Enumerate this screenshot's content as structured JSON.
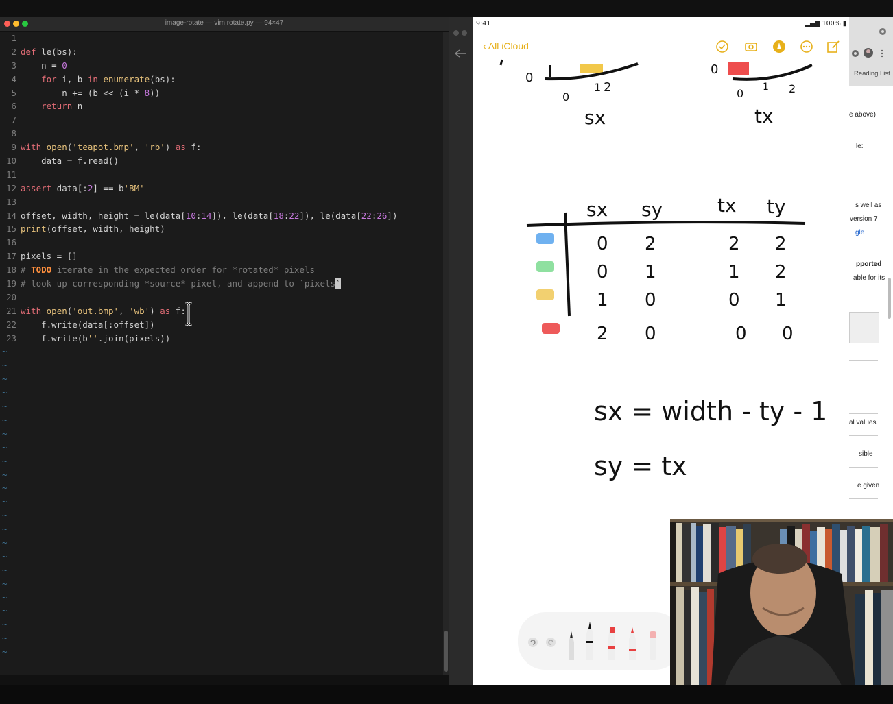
{
  "terminal": {
    "title": "image-rotate — vim rotate.py — 94×47",
    "lines": [
      {
        "n": "1"
      },
      {
        "n": "2"
      },
      {
        "n": "3"
      },
      {
        "n": "4"
      },
      {
        "n": "5"
      },
      {
        "n": "6"
      },
      {
        "n": "7"
      },
      {
        "n": "8"
      },
      {
        "n": "9"
      },
      {
        "n": "10"
      },
      {
        "n": "11"
      },
      {
        "n": "12"
      },
      {
        "n": "13"
      },
      {
        "n": "14"
      },
      {
        "n": "15"
      },
      {
        "n": "16"
      },
      {
        "n": "17"
      },
      {
        "n": "18"
      },
      {
        "n": "19"
      },
      {
        "n": "20"
      },
      {
        "n": "21"
      },
      {
        "n": "22"
      },
      {
        "n": "23"
      }
    ],
    "code": {
      "l2": {
        "kw": "def",
        "rest": " le(bs):"
      },
      "l3": {
        "a": "    n = ",
        "num": "0"
      },
      "l4": {
        "kw1": "    for",
        "a": " i, b ",
        "kw2": "in",
        "sp": " ",
        "fn": "enumerate",
        "b": "(bs):"
      },
      "l5": {
        "a": "        n += (b << (i * ",
        "num": "8",
        "b": "))"
      },
      "l6": {
        "kw": "    return",
        "a": " n"
      },
      "l9": {
        "kw1": "with",
        "sp": " ",
        "fn": "open",
        "a": "(",
        "s1": "'teapot.bmp'",
        "b": ", ",
        "s2": "'rb'",
        "c": ") ",
        "kw2": "as",
        "d": " f:"
      },
      "l10": {
        "a": "    data = f.read()"
      },
      "l12": {
        "kw": "assert",
        "a": " data[:",
        "num": "2",
        "b": "] == b",
        "s": "'BM'"
      },
      "l14": {
        "a": "offset, width, height = le(data[",
        "n1": "10",
        "c1": ":",
        "n2": "14",
        "b": "]), le(data[",
        "n3": "18",
        "c2": ":",
        "n4": "22",
        "c": "]), le(data[",
        "n5": "22",
        "c3": ":",
        "n6": "26",
        "d": "])"
      },
      "l15": {
        "fn": "print",
        "a": "(offset, width, height)"
      },
      "l17": {
        "a": "pixels = []"
      },
      "l18": {
        "h": "# ",
        "todo": "TODO",
        "rest": " iterate in the expected order for *rotated* pixels"
      },
      "l19": {
        "rest": "# look up corresponding *source* pixel, and append to `pixels",
        "cur": "`"
      },
      "l21": {
        "kw1": "with",
        "sp": " ",
        "fn": "open",
        "a": "(",
        "s1": "'out.bmp'",
        "b": ", ",
        "s2": "'wb'",
        "c": ") ",
        "kw2": "as",
        "d": " f:"
      },
      "l22": {
        "a": "    f.write(data[:offset])"
      },
      "l23": {
        "a": "    f.write(b",
        "s": "''",
        "b": ".join(pixels))"
      }
    },
    "tilde": "~"
  },
  "ipad": {
    "time": "9:41",
    "battery": "100%",
    "back_label": "All iCloud",
    "notes": {
      "top_left_label": "sx",
      "top_right_label": "tx",
      "top_left_axis": [
        "0",
        "1",
        "2"
      ],
      "top_right_axis": [
        "0",
        "1",
        "2"
      ],
      "table_headers": [
        "sx",
        "sy",
        "tx",
        "ty"
      ],
      "table_rows": [
        {
          "color": "#6fb1f0",
          "sx": "0",
          "sy": "2",
          "tx": "2",
          "ty": "2"
        },
        {
          "color": "#8fe0a0",
          "sx": "0",
          "sy": "1",
          "tx": "1",
          "ty": "2"
        },
        {
          "color": "#f2d070",
          "sx": "1",
          "sy": "0",
          "tx": "0",
          "ty": "1"
        },
        {
          "color": "#ee5a5a",
          "sx": "2",
          "sy": "0",
          "tx": "0",
          "ty": "0"
        }
      ],
      "formula1": "sx = width - ty - 1",
      "formula2": "sy = tx"
    }
  },
  "browser": {
    "reading_list": "Reading List",
    "snippets": [
      "e above)",
      "le:",
      "s well as",
      "version 7",
      "gle",
      "pported",
      "able for its",
      "al values",
      "sible",
      "e given"
    ]
  },
  "colors": {
    "accent": "#e7b01a",
    "terminal_bg": "#1b1b1b",
    "keyword": "#e06c75",
    "string": "#e5c07b",
    "number": "#c678dd"
  }
}
